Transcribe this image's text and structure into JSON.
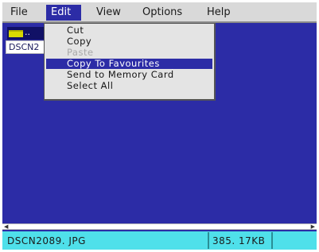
{
  "menubar": {
    "items": [
      "File",
      "Edit",
      "View",
      "Options",
      "Help"
    ],
    "active": "Edit"
  },
  "file_list": {
    "folder_label": "..",
    "selected_file": "DSCN2"
  },
  "edit_menu": {
    "items": [
      {
        "label": "Cut",
        "state": "enabled"
      },
      {
        "label": "Copy",
        "state": "enabled"
      },
      {
        "label": "Paste",
        "state": "disabled"
      },
      {
        "label": "Copy To Favourites",
        "state": "highlighted"
      },
      {
        "label": "Send to Memory Card",
        "state": "enabled"
      },
      {
        "label": "Select All",
        "state": "enabled"
      }
    ]
  },
  "scrollbar": {
    "left_icon": "arrow-left-icon",
    "right_icon": "arrow-right-icon"
  },
  "statusbar": {
    "filename": "DSCN2089. JPG",
    "filesize": "385. 17KB"
  },
  "colors": {
    "background": "#2c2ca6",
    "menubar": "#d9d9d9",
    "highlight": "#2c2ca6",
    "statusbar": "#4fe0ea",
    "folder": "#d8d800"
  }
}
